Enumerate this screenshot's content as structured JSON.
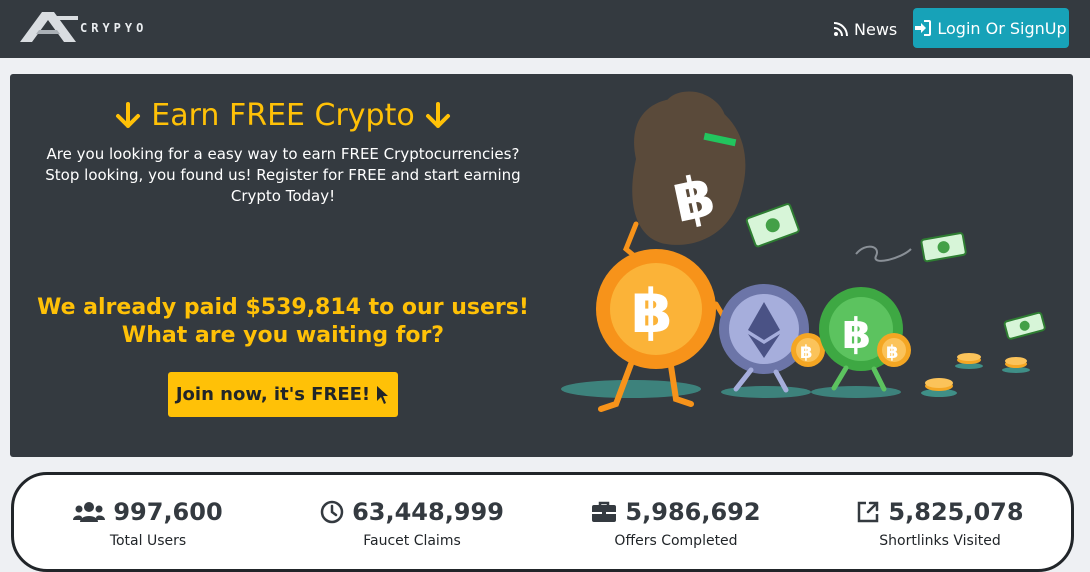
{
  "navbar": {
    "logo_text": "CRYPYO",
    "news_label": "News",
    "login_label": "Login Or SignUp"
  },
  "hero": {
    "title": "Earn FREE Crypto",
    "description": "Are you looking for a easy way to earn FREE Cryptocurrencies? Stop looking, you found us! Register for FREE and start earning Crypto Today!",
    "paid_line1": "We already paid $539,814 to our users!",
    "paid_line2": "What are you waiting for?",
    "cta_label": "Join now, it's FREE!"
  },
  "stats": [
    {
      "icon": "users-icon",
      "value": "997,600",
      "label": "Total Users"
    },
    {
      "icon": "clock-icon",
      "value": "63,448,999",
      "label": "Faucet Claims"
    },
    {
      "icon": "briefcase-icon",
      "value": "5,986,692",
      "label": "Offers Completed"
    },
    {
      "icon": "external-link-icon",
      "value": "5,825,078",
      "label": "Shortlinks Visited"
    }
  ],
  "colors": {
    "navbar_bg": "#343a40",
    "accent_yellow": "#ffc107",
    "login_teal": "#17a2b8",
    "bitcoin_orange": "#f7931a",
    "bitcoin_cash_green": "#4caf50",
    "ethereum_gray": "#8d96c8"
  }
}
